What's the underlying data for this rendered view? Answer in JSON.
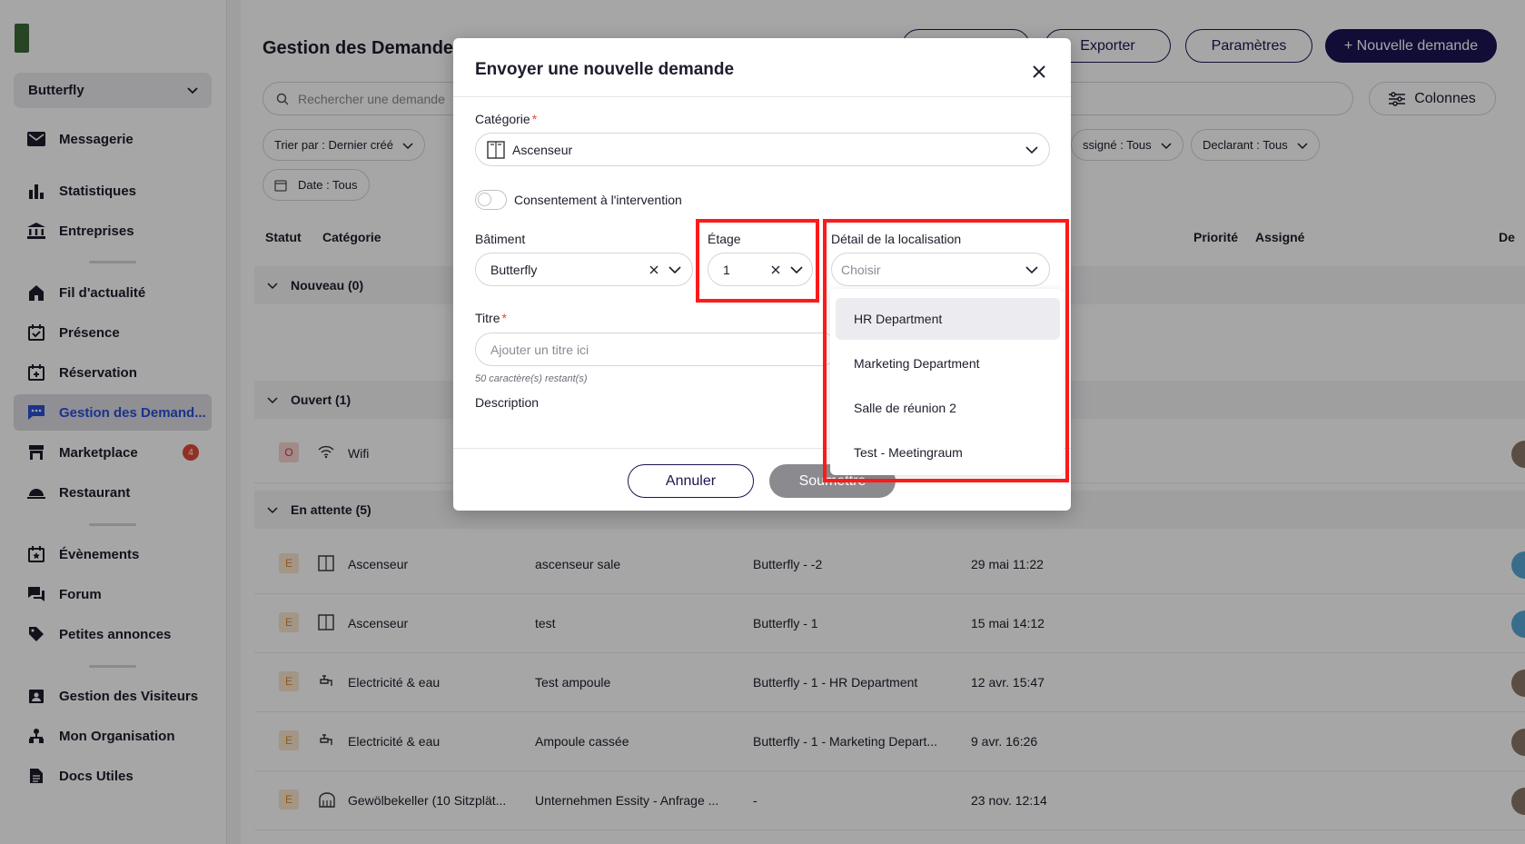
{
  "sidebar": {
    "site_select": "Butterfly",
    "nav": [
      {
        "label": "Messagerie",
        "icon": "mail-icon"
      },
      {
        "label": "Statistiques",
        "icon": "bar-chart-icon"
      },
      {
        "label": "Entreprises",
        "icon": "bank-icon"
      },
      {
        "label": "Fil d'actualité",
        "icon": "home-icon"
      },
      {
        "label": "Présence",
        "icon": "calendar-check-icon"
      },
      {
        "label": "Réservation",
        "icon": "calendar-plus-icon"
      },
      {
        "label": "Gestion des Demand...",
        "icon": "chat-icon"
      },
      {
        "label": "Marketplace",
        "icon": "store-icon",
        "badge": "4"
      },
      {
        "label": "Restaurant",
        "icon": "cloche-icon"
      },
      {
        "label": "Évènements",
        "icon": "calendar-star-icon"
      },
      {
        "label": "Forum",
        "icon": "forum-icon"
      },
      {
        "label": "Petites annonces",
        "icon": "tag-icon"
      },
      {
        "label": "Gestion des Visiteurs",
        "icon": "badge-icon"
      },
      {
        "label": "Mon Organisation",
        "icon": "org-icon"
      },
      {
        "label": "Docs Utiles",
        "icon": "document-icon"
      }
    ]
  },
  "main": {
    "title": "Gestion des Demandes",
    "buttons": {
      "exporter": "Exporter",
      "parametres": "Paramètres",
      "nouvelle": "+ Nouvelle demande"
    },
    "search_placeholder": "Rechercher une demande",
    "colonnes": "Colonnes",
    "filters": {
      "sort": "Trier par : Dernier créé",
      "assigne": "ssigné : Tous",
      "declarant": "Declarant : Tous",
      "date": "Date : Tous"
    },
    "columns": {
      "statut": "Statut",
      "categorie": "Catégorie",
      "priorite": "Priorité",
      "assigne": "Assigné",
      "de": "De"
    },
    "groups": {
      "nouveau": "Nouveau (0)",
      "ouvert": "Ouvert (1)",
      "attente": "En attente (5)"
    },
    "rows": [
      {
        "status": "O",
        "category": "Wifi",
        "title": "",
        "location": "",
        "date": ""
      },
      {
        "status": "E",
        "category": "Ascenseur",
        "title": "ascenseur sale",
        "location": "Butterfly - -2",
        "date": "29 mai 11:22"
      },
      {
        "status": "E",
        "category": "Ascenseur",
        "title": "test",
        "location": "Butterfly - 1",
        "date": "15 mai 14:12"
      },
      {
        "status": "E",
        "category": "Electricité & eau",
        "title": "Test ampoule",
        "location": "Butterfly - 1 - HR Department",
        "date": "12 avr. 15:47"
      },
      {
        "status": "E",
        "category": "Electricité & eau",
        "title": "Ampoule cassée",
        "location": "Butterfly - 1 - Marketing Depart...",
        "date": "9 avr. 16:26"
      },
      {
        "status": "E",
        "category": "Gewölbekeller (10 Sitzplät...",
        "title": "Unternehmen Essity - Anfrage ...",
        "location": "-",
        "date": "23 nov. 12:14"
      }
    ]
  },
  "modal": {
    "title": "Envoyer une nouvelle demande",
    "categorie_label": "Catégorie",
    "categorie_value": "Ascenseur",
    "consent_label": "Consentement à l'intervention",
    "batiment_label": "Bâtiment",
    "batiment_value": "Butterfly",
    "etage_label": "Étage",
    "etage_value": "1",
    "detail_label": "Détail de la localisation",
    "detail_placeholder": "Choisir",
    "titre_label": "Titre",
    "titre_placeholder": "Ajouter un titre ici",
    "titre_help": "50 caractère(s) restant(s)",
    "description_label": "Description",
    "cancel": "Annuler",
    "submit": "Soumettre",
    "options": [
      "HR Department",
      "Marketing Department",
      "Salle de réunion 2",
      "Test - Meetingraum"
    ]
  },
  "colors": {
    "brand": "#1b1554",
    "active_nav": "#2a4fd6",
    "highlight": "#ff1a1a",
    "required": "#e04a3a"
  }
}
